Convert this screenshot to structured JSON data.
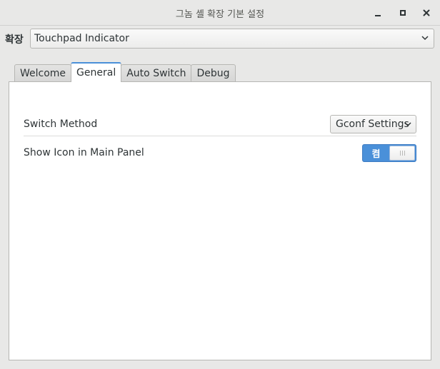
{
  "window": {
    "title": "그놈 셸 확장 기본 설정",
    "buttons": {
      "minimize": "minimize-icon",
      "maximize": "maximize-icon",
      "close": "close-icon"
    }
  },
  "extension": {
    "label": "확장",
    "selected": "Touchpad Indicator"
  },
  "tabs": [
    {
      "label": "Welcome",
      "active": false
    },
    {
      "label": "General",
      "active": true
    },
    {
      "label": "Auto Switch",
      "active": false
    },
    {
      "label": "Debug",
      "active": false
    }
  ],
  "general": {
    "switch_method": {
      "label": "Switch Method",
      "value": "Gconf Settings"
    },
    "show_icon": {
      "label": "Show Icon in Main Panel",
      "state_label": "켬",
      "on": true
    }
  },
  "colors": {
    "accent": "#4a90d9",
    "background": "#e8e8e7",
    "panel": "#ffffff"
  }
}
